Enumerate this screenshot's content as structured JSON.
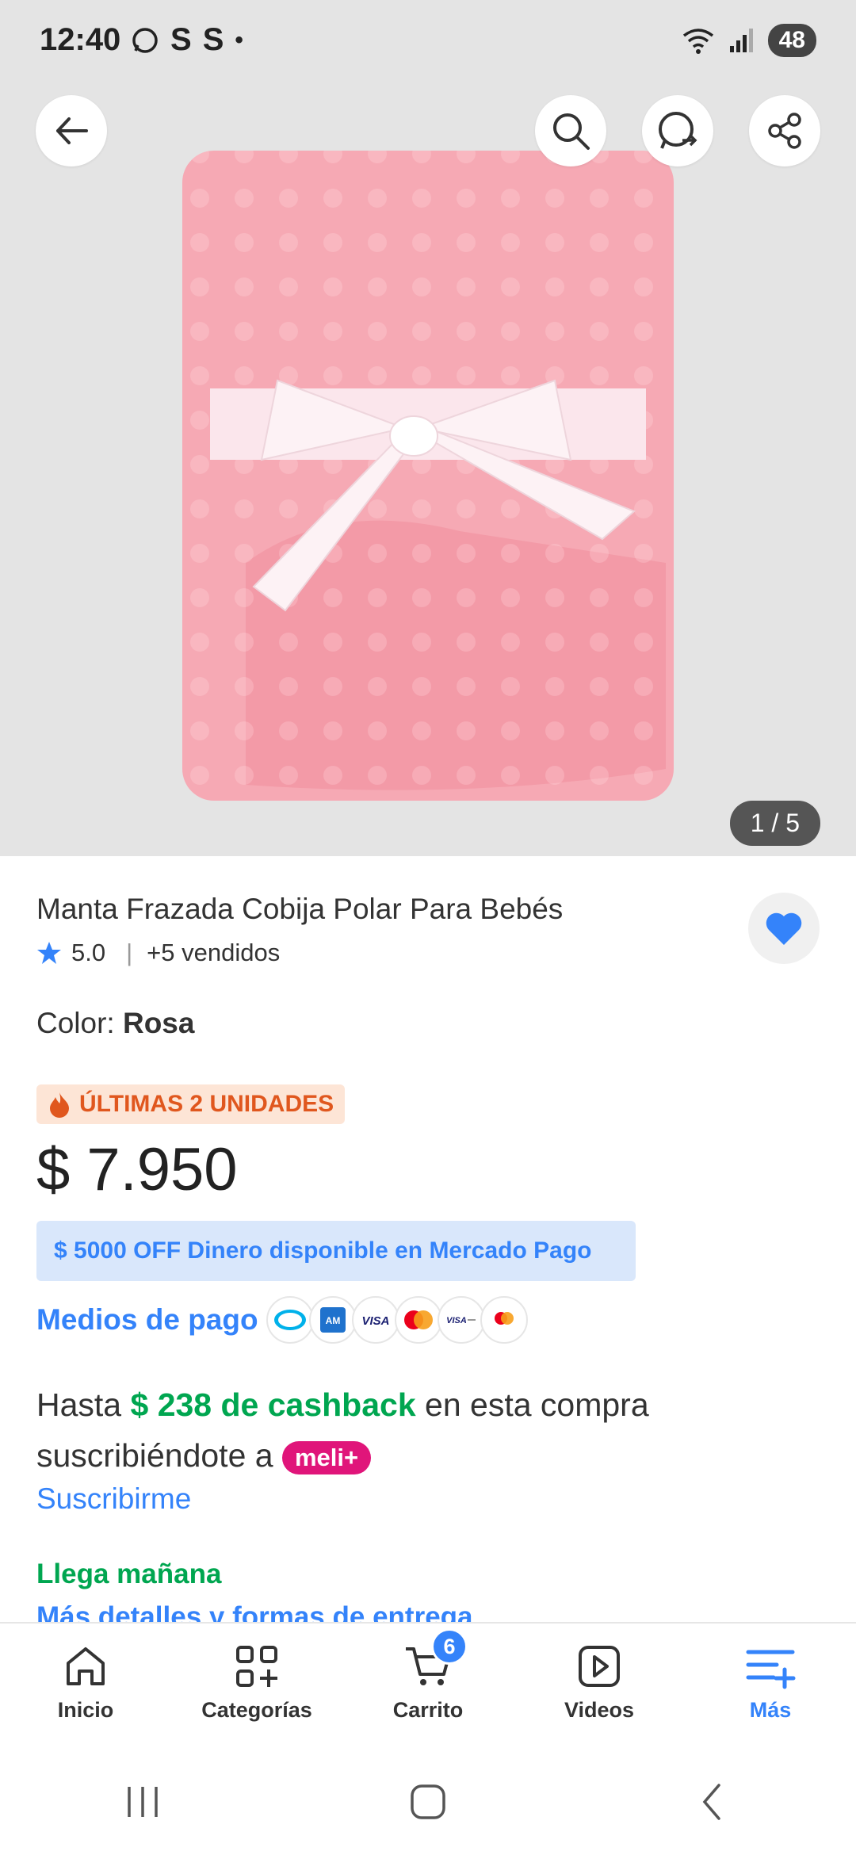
{
  "status_bar": {
    "time": "12:40",
    "battery": "48",
    "app_icons": [
      "whatsapp-icon",
      "s-icon",
      "s-icon",
      "dot"
    ]
  },
  "gallery": {
    "counter": "1 / 5"
  },
  "product": {
    "title": "Manta Frazada Cobija Polar Para Bebés",
    "rating": "5.0",
    "sold": "+5 vendidos",
    "color_label": "Color: ",
    "color_value": "Rosa",
    "urgency": "ÚLTIMAS 2 UNIDADES",
    "price": "$ 7.950",
    "promo": "$ 5000 OFF Dinero disponible en Mercado Pago",
    "payment_label": "Medios de pago",
    "cashback_prefix": "Hasta ",
    "cashback_amount": "$ 238 de cashback",
    "cashback_suffix": " en esta compra",
    "cashback_line2": "suscribiéndote a ",
    "meli_plus": "meli+",
    "subscribe": "Suscribirme",
    "delivery": "Llega mañana",
    "more_details": "Más detalles y formas de entrega"
  },
  "payment_methods": [
    "mercado-pago",
    "amex",
    "visa",
    "mastercard",
    "visa-debito",
    "mastercard-debito"
  ],
  "bottom_nav": [
    {
      "label": "Inicio",
      "icon": "home-icon"
    },
    {
      "label": "Categorías",
      "icon": "categories-icon"
    },
    {
      "label": "Carrito",
      "icon": "cart-icon",
      "badge": "6"
    },
    {
      "label": "Videos",
      "icon": "play-icon"
    },
    {
      "label": "Más",
      "icon": "menu-plus-icon",
      "active": true
    }
  ],
  "colors": {
    "accent": "#3483fa",
    "green": "#00a650",
    "urgency": "#e0571e",
    "meli_plus": "#e0157a"
  }
}
